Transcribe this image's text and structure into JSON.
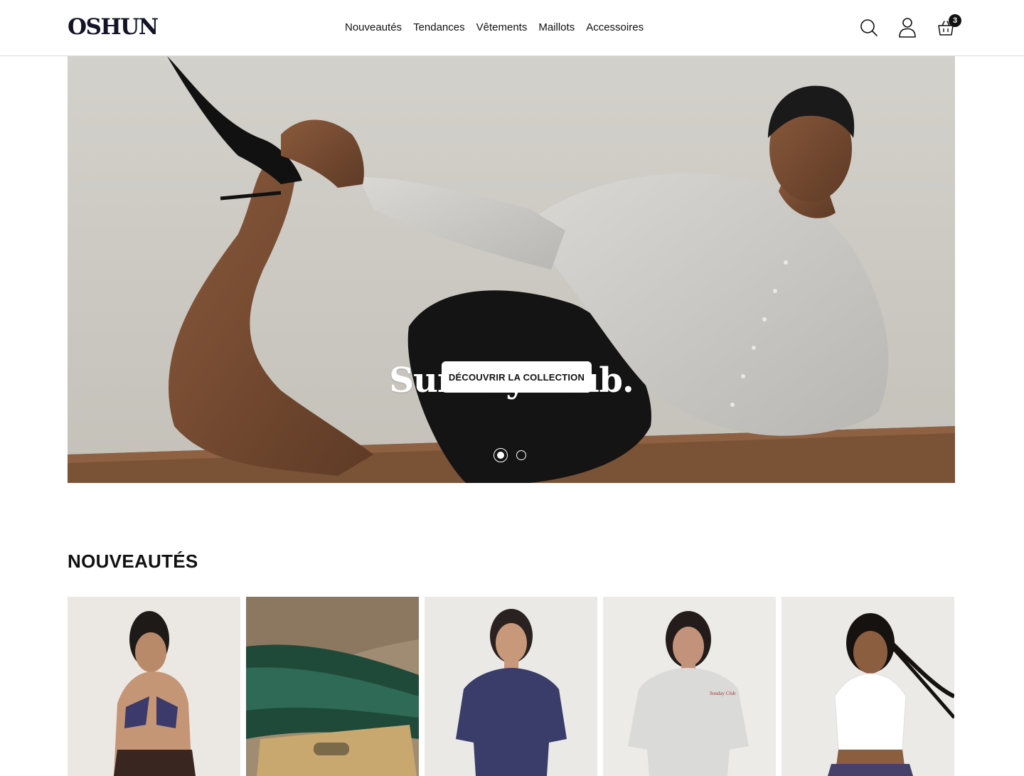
{
  "brand": {
    "logo": "OSHUN"
  },
  "nav": {
    "items": [
      {
        "label": "Nouveautés"
      },
      {
        "label": "Tendances"
      },
      {
        "label": "Vêtements"
      },
      {
        "label": "Maillots"
      },
      {
        "label": "Accessoires"
      }
    ]
  },
  "header_icons": {
    "search": "search-icon",
    "account": "user-icon",
    "cart": "basket-icon",
    "cart_count": "3"
  },
  "hero": {
    "title": "Sunday Club.",
    "cta_label": "DÉCOUVRIR LA COLLECTION",
    "slides_total": 2,
    "active_slide": 1
  },
  "new_arrivals": {
    "title": "NOUVEAUTÉS",
    "products": [
      {
        "image": "bikini-top-model"
      },
      {
        "image": "straw-bag"
      },
      {
        "image": "navy-oversized-tee"
      },
      {
        "image": "grey-oversized-tee"
      },
      {
        "image": "white-tank-top"
      }
    ]
  },
  "colors": {
    "text": "#111111",
    "logo": "#141428",
    "hero_bg": "#cfcdc7",
    "border": "#dcdcdc"
  }
}
